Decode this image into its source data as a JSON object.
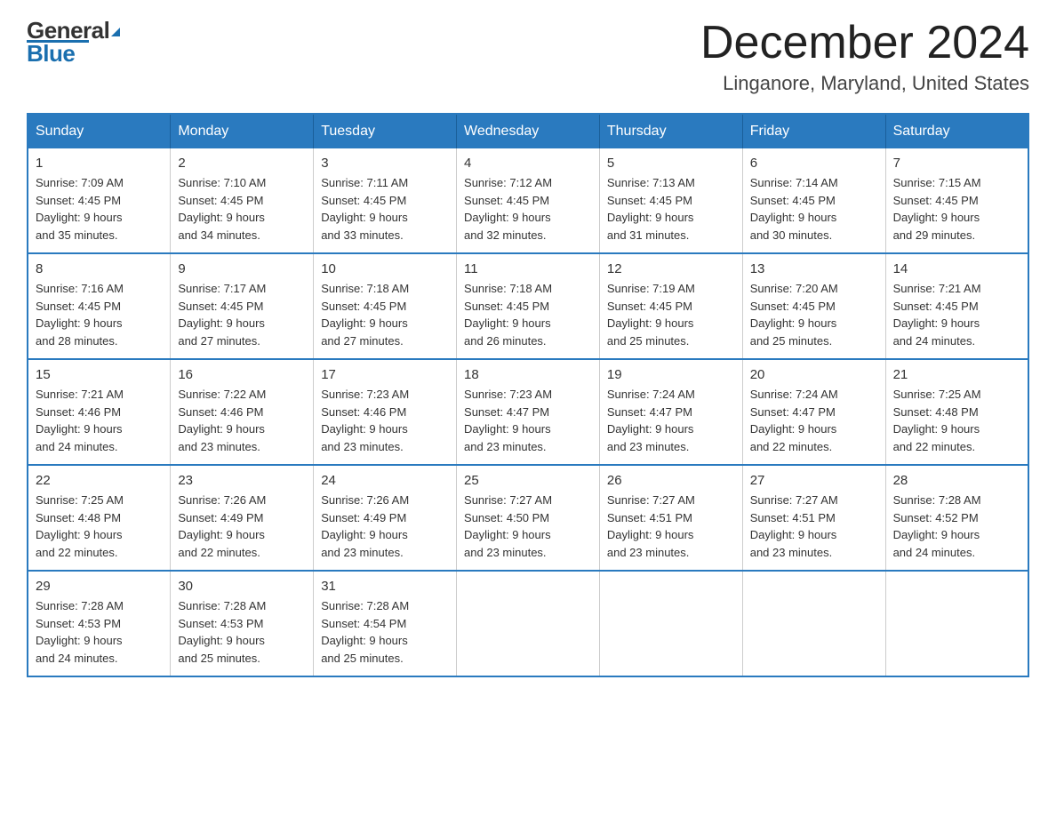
{
  "logo": {
    "line1": "General",
    "triangle": "▶",
    "line2": "Blue"
  },
  "header": {
    "month": "December 2024",
    "location": "Linganore, Maryland, United States"
  },
  "days_of_week": [
    "Sunday",
    "Monday",
    "Tuesday",
    "Wednesday",
    "Thursday",
    "Friday",
    "Saturday"
  ],
  "weeks": [
    [
      {
        "day": "1",
        "sunrise": "7:09 AM",
        "sunset": "4:45 PM",
        "daylight": "9 hours and 35 minutes."
      },
      {
        "day": "2",
        "sunrise": "7:10 AM",
        "sunset": "4:45 PM",
        "daylight": "9 hours and 34 minutes."
      },
      {
        "day": "3",
        "sunrise": "7:11 AM",
        "sunset": "4:45 PM",
        "daylight": "9 hours and 33 minutes."
      },
      {
        "day": "4",
        "sunrise": "7:12 AM",
        "sunset": "4:45 PM",
        "daylight": "9 hours and 32 minutes."
      },
      {
        "day": "5",
        "sunrise": "7:13 AM",
        "sunset": "4:45 PM",
        "daylight": "9 hours and 31 minutes."
      },
      {
        "day": "6",
        "sunrise": "7:14 AM",
        "sunset": "4:45 PM",
        "daylight": "9 hours and 30 minutes."
      },
      {
        "day": "7",
        "sunrise": "7:15 AM",
        "sunset": "4:45 PM",
        "daylight": "9 hours and 29 minutes."
      }
    ],
    [
      {
        "day": "8",
        "sunrise": "7:16 AM",
        "sunset": "4:45 PM",
        "daylight": "9 hours and 28 minutes."
      },
      {
        "day": "9",
        "sunrise": "7:17 AM",
        "sunset": "4:45 PM",
        "daylight": "9 hours and 27 minutes."
      },
      {
        "day": "10",
        "sunrise": "7:18 AM",
        "sunset": "4:45 PM",
        "daylight": "9 hours and 27 minutes."
      },
      {
        "day": "11",
        "sunrise": "7:18 AM",
        "sunset": "4:45 PM",
        "daylight": "9 hours and 26 minutes."
      },
      {
        "day": "12",
        "sunrise": "7:19 AM",
        "sunset": "4:45 PM",
        "daylight": "9 hours and 25 minutes."
      },
      {
        "day": "13",
        "sunrise": "7:20 AM",
        "sunset": "4:45 PM",
        "daylight": "9 hours and 25 minutes."
      },
      {
        "day": "14",
        "sunrise": "7:21 AM",
        "sunset": "4:45 PM",
        "daylight": "9 hours and 24 minutes."
      }
    ],
    [
      {
        "day": "15",
        "sunrise": "7:21 AM",
        "sunset": "4:46 PM",
        "daylight": "9 hours and 24 minutes."
      },
      {
        "day": "16",
        "sunrise": "7:22 AM",
        "sunset": "4:46 PM",
        "daylight": "9 hours and 23 minutes."
      },
      {
        "day": "17",
        "sunrise": "7:23 AM",
        "sunset": "4:46 PM",
        "daylight": "9 hours and 23 minutes."
      },
      {
        "day": "18",
        "sunrise": "7:23 AM",
        "sunset": "4:47 PM",
        "daylight": "9 hours and 23 minutes."
      },
      {
        "day": "19",
        "sunrise": "7:24 AM",
        "sunset": "4:47 PM",
        "daylight": "9 hours and 23 minutes."
      },
      {
        "day": "20",
        "sunrise": "7:24 AM",
        "sunset": "4:47 PM",
        "daylight": "9 hours and 22 minutes."
      },
      {
        "day": "21",
        "sunrise": "7:25 AM",
        "sunset": "4:48 PM",
        "daylight": "9 hours and 22 minutes."
      }
    ],
    [
      {
        "day": "22",
        "sunrise": "7:25 AM",
        "sunset": "4:48 PM",
        "daylight": "9 hours and 22 minutes."
      },
      {
        "day": "23",
        "sunrise": "7:26 AM",
        "sunset": "4:49 PM",
        "daylight": "9 hours and 22 minutes."
      },
      {
        "day": "24",
        "sunrise": "7:26 AM",
        "sunset": "4:49 PM",
        "daylight": "9 hours and 23 minutes."
      },
      {
        "day": "25",
        "sunrise": "7:27 AM",
        "sunset": "4:50 PM",
        "daylight": "9 hours and 23 minutes."
      },
      {
        "day": "26",
        "sunrise": "7:27 AM",
        "sunset": "4:51 PM",
        "daylight": "9 hours and 23 minutes."
      },
      {
        "day": "27",
        "sunrise": "7:27 AM",
        "sunset": "4:51 PM",
        "daylight": "9 hours and 23 minutes."
      },
      {
        "day": "28",
        "sunrise": "7:28 AM",
        "sunset": "4:52 PM",
        "daylight": "9 hours and 24 minutes."
      }
    ],
    [
      {
        "day": "29",
        "sunrise": "7:28 AM",
        "sunset": "4:53 PM",
        "daylight": "9 hours and 24 minutes."
      },
      {
        "day": "30",
        "sunrise": "7:28 AM",
        "sunset": "4:53 PM",
        "daylight": "9 hours and 25 minutes."
      },
      {
        "day": "31",
        "sunrise": "7:28 AM",
        "sunset": "4:54 PM",
        "daylight": "9 hours and 25 minutes."
      },
      null,
      null,
      null,
      null
    ]
  ],
  "labels": {
    "sunrise": "Sunrise: ",
    "sunset": "Sunset: ",
    "daylight": "Daylight: "
  }
}
